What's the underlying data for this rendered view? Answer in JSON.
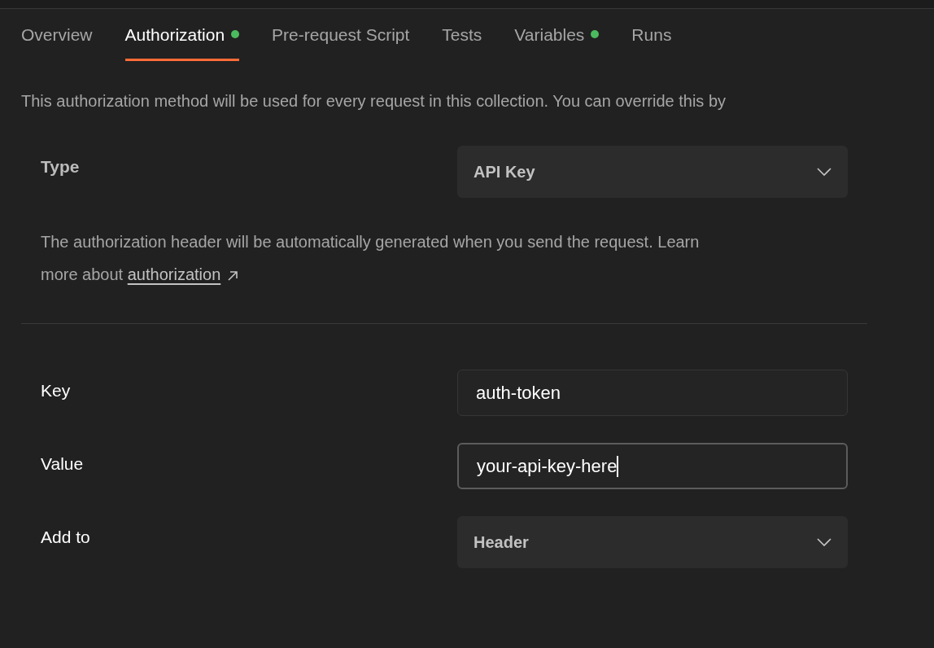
{
  "tabs": [
    {
      "label": "Overview",
      "selected": false,
      "dot": false
    },
    {
      "label": "Authorization",
      "selected": true,
      "dot": true
    },
    {
      "label": "Pre-request Script",
      "selected": false,
      "dot": false
    },
    {
      "label": "Tests",
      "selected": false,
      "dot": false
    },
    {
      "label": "Variables",
      "selected": false,
      "dot": true
    },
    {
      "label": "Runs",
      "selected": false,
      "dot": false
    }
  ],
  "description": "This authorization method will be used for every request in this collection. You can override this by",
  "type_row": {
    "label": "Type",
    "value": "API Key"
  },
  "help": {
    "text": "The authorization header will be automatically generated when you send the request. Learn more about",
    "link": "authorization"
  },
  "fields": [
    {
      "kind": "input",
      "label": "Key",
      "value": "auth-token",
      "focused": false
    },
    {
      "kind": "input",
      "label": "Value",
      "value": "your-api-key-here",
      "focused": true
    },
    {
      "kind": "select",
      "label": "Add to",
      "value": "Header"
    }
  ]
}
